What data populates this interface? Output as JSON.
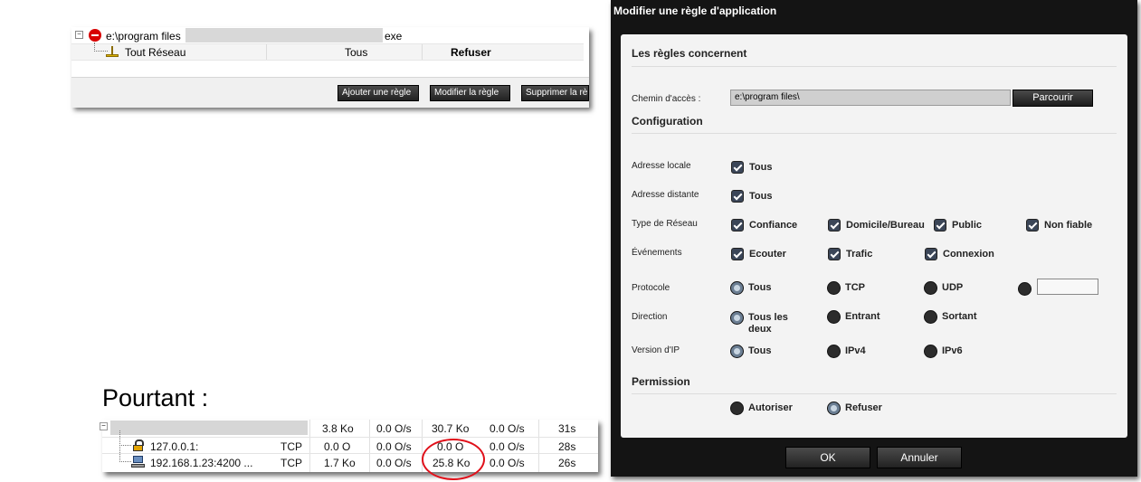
{
  "rules_panel": {
    "path_prefix": "e:\\program files",
    "path_suffix": "exe",
    "subrule": {
      "network": "Tout Réseau",
      "scope": "Tous",
      "action": "Refuser"
    },
    "buttons": {
      "add": "Ajouter une règle",
      "modify": "Modifier la règle",
      "delete": "Supprimer la rè"
    }
  },
  "pourtant_label": "Pourtant :",
  "connections": {
    "rows": [
      {
        "name": "",
        "proto": "",
        "sent": "3.8  Ko",
        "sent_rate": "0.0  O/s",
        "recv": "30.7  Ko",
        "recv_rate": "0.0  O/s",
        "time": "31s"
      },
      {
        "name": "127.0.0.1:",
        "proto": "TCP",
        "sent": "0.0  O",
        "sent_rate": "0.0  O/s",
        "recv": "0.0  O",
        "recv_rate": "0.0  O/s",
        "time": "28s"
      },
      {
        "name": "192.168.1.23:4200 ...",
        "proto": "TCP",
        "sent": "1.7  Ko",
        "sent_rate": "0.0  O/s",
        "recv": "25.8  Ko",
        "recv_rate": "0.0  O/s",
        "time": "26s"
      }
    ]
  },
  "dialog": {
    "title": "Modifier une règle d'application",
    "sections": {
      "concern": "Les règles concernent",
      "config": "Configuration",
      "permission": "Permission"
    },
    "path_label": "Chemin d'accès :",
    "path_value": "e:\\program files\\",
    "browse": "Parcourir",
    "labels": {
      "local": "Adresse locale",
      "remote": "Adresse distante",
      "network_type": "Type de Réseau",
      "events": "Événements",
      "protocol": "Protocole",
      "direction": "Direction",
      "ip_version": "Version d'IP"
    },
    "local_opt": "Tous",
    "remote_opt": "Tous",
    "network_types": [
      "Confiance",
      "Domicile/Bureau",
      "Public",
      "Non fiable"
    ],
    "events": [
      "Ecouter",
      "Trafic",
      "Connexion"
    ],
    "protocols": [
      "Tous",
      "TCP",
      "UDP"
    ],
    "protocol_selected": "Tous",
    "directions": [
      "Tous les deux",
      "Entrant",
      "Sortant"
    ],
    "direction_selected": "Tous les deux",
    "ip_versions": [
      "Tous",
      "IPv4",
      "IPv6"
    ],
    "ip_selected": "Tous",
    "permissions": [
      "Autoriser",
      "Refuser"
    ],
    "permission_selected": "Refuser",
    "ok": "OK",
    "cancel": "Annuler"
  }
}
